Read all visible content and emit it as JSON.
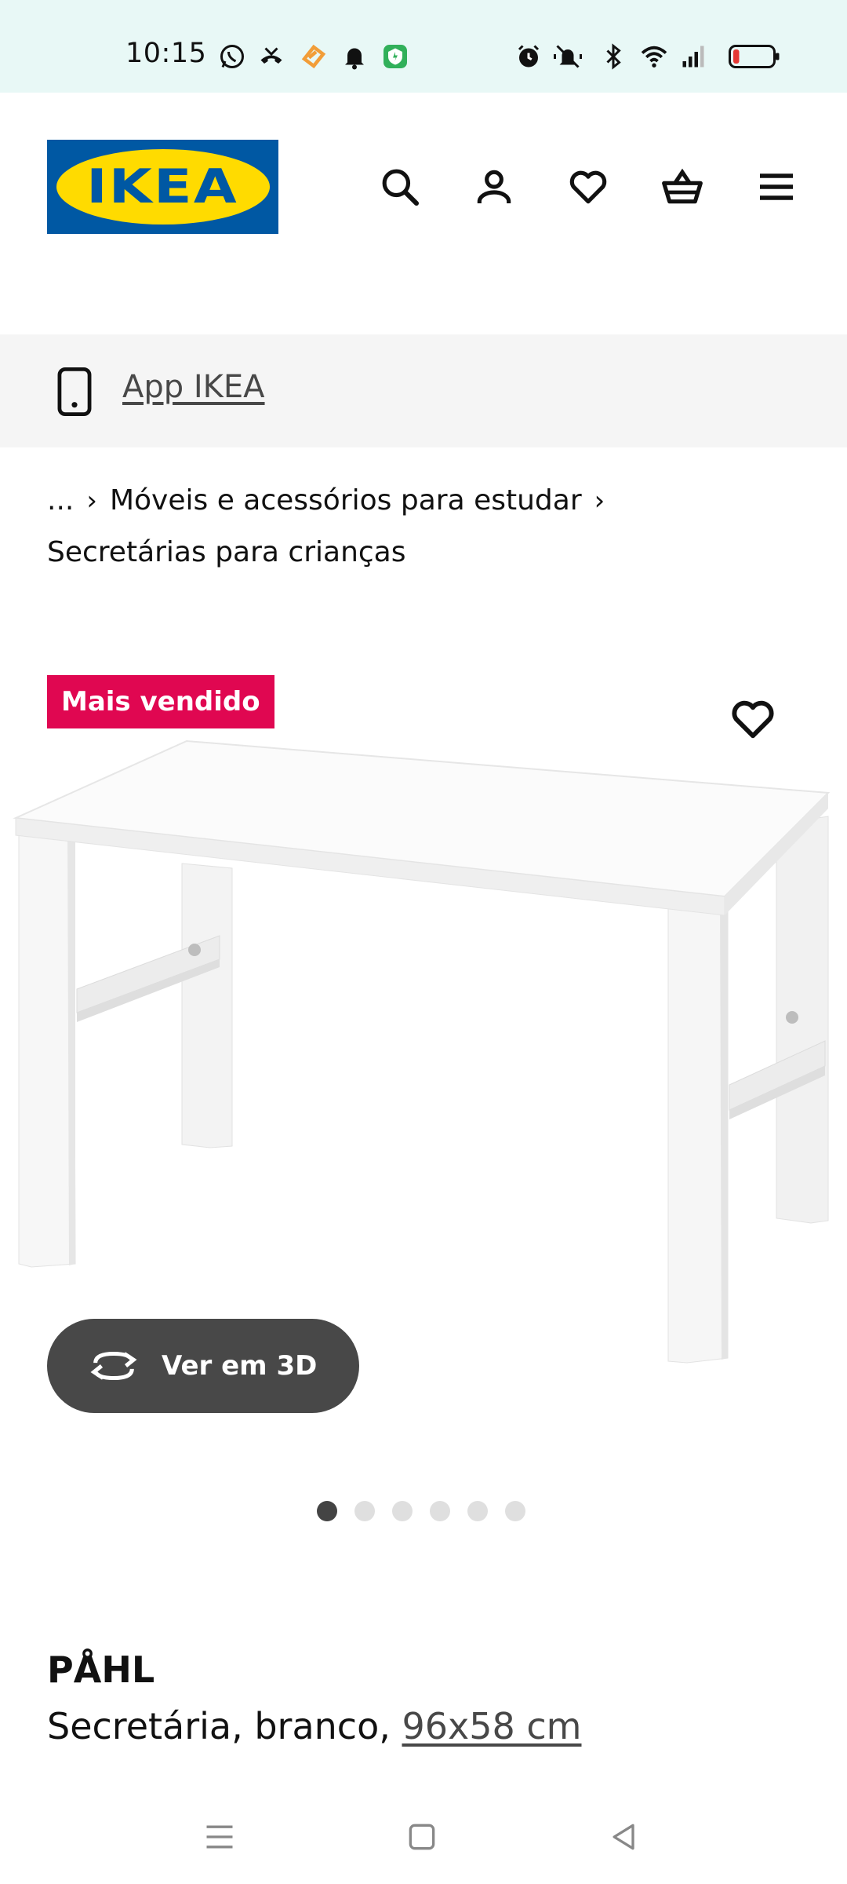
{
  "status_bar": {
    "time": "10:15",
    "left_icons": [
      "whatsapp-icon",
      "missed-call-icon",
      "app-notification-icon",
      "bell-icon",
      "security-app-icon"
    ],
    "right_icons": [
      "alarm-icon",
      "silent-mode-icon",
      "bluetooth-icon",
      "wifi-icon",
      "signal-icon",
      "battery-low-icon"
    ],
    "battery_color": "#e53935"
  },
  "header": {
    "logo_text": "IKEA",
    "brand_blue": "#0058a3",
    "brand_yellow": "#ffdb00",
    "icons": [
      "search-icon",
      "account-icon",
      "heart-icon",
      "basket-icon",
      "menu-icon"
    ]
  },
  "app_banner": {
    "label": "App IKEA",
    "icon": "phone-icon"
  },
  "breadcrumb": {
    "ellipsis": "...",
    "items": [
      "Móveis e acessórios para estudar",
      "Secretárias para crianças"
    ],
    "separator": "›"
  },
  "product": {
    "badge": "Mais vendido",
    "badge_color": "#e00751",
    "view_3d_label": "Ver em 3D",
    "image_count": 6,
    "active_image": 1,
    "name": "PÅHL",
    "description": "Secretária, branco, ",
    "dimensions": "96x58 cm"
  },
  "nav_bar": {
    "buttons": [
      "recent-apps-icon",
      "home-icon",
      "back-icon"
    ]
  }
}
